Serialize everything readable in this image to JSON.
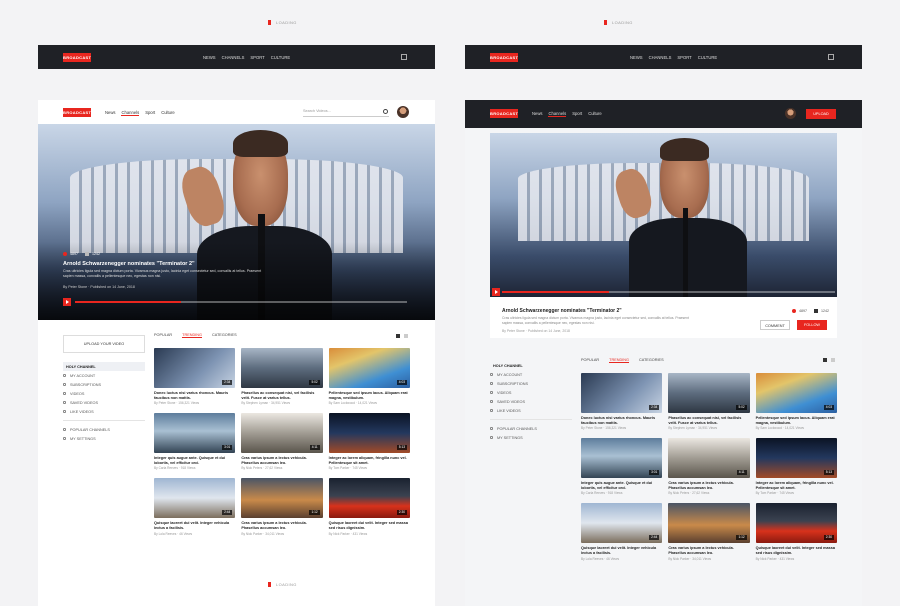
{
  "brand": {
    "logo": "BROADCAST",
    "accent": "#e8261f"
  },
  "loading_label": "LOADING",
  "preview_bar": {
    "links": [
      "NEWS",
      "CHANNELS",
      "SPORT",
      "CULTURE"
    ]
  },
  "nav": {
    "links": [
      "News",
      "Channels",
      "Sport",
      "Culture"
    ],
    "active": "Channels",
    "search_placeholder": "Search Videos...",
    "upload_button": "UPLOAD"
  },
  "hero": {
    "title": "Arnold Schwarzenegger nominates \"Terminator 2\"",
    "description": "Cras ultricies ligula sed magna dictum porta. Vivamus magna justo, lacinia eget consectetur sed, convallis at tellus. Praesent sapien massa, convallis a pellentesque nec, egestas non nisi.",
    "meta": "By Peter Stone · Published on 14 June, 2018",
    "likes": "4897",
    "comments": "1242",
    "progress": 0.32,
    "share_label": "COMMENT",
    "subscribe_label": "FOLLOW"
  },
  "sidebar": {
    "upload": "UPLOAD YOUR VIDEO",
    "items": [
      {
        "label": "HOLY CHANNEL",
        "active": true,
        "icon": "home-icon"
      },
      {
        "label": "MY ACCOUNT",
        "icon": "user-icon"
      },
      {
        "label": "SUBSCRIPTIONS",
        "icon": "subscriptions-icon"
      },
      {
        "label": "VIDEOS",
        "icon": "video-icon"
      },
      {
        "label": "SAVED VIDEOS",
        "icon": "bookmark-icon"
      },
      {
        "label": "LIKE VIDEOS",
        "icon": "heart-icon"
      }
    ],
    "extra": [
      {
        "label": "POPULAR CHANNELS",
        "icon": "star-icon"
      },
      {
        "label": "MY SETTINGS",
        "icon": "gear-icon"
      }
    ]
  },
  "tabs": [
    "POPULAR",
    "TRENDING",
    "CATEGORIES"
  ],
  "active_tab": "TRENDING",
  "videos": [
    {
      "title": "Donec luctus nisi varius rhoncus. Mauris faucibus non mattis.",
      "author": "By Peter Stone",
      "views": "156,321 Views",
      "duration": "2:34"
    },
    {
      "title": "Phasellus ac consequat nisi, vel facilisis velit. Fusce at varius tellus.",
      "author": "By Stephen Lyman",
      "views": "34,951 Views",
      "duration": "5:02"
    },
    {
      "title": "Pellentesque sed ipsum lacus. Aliquam erat magna, vestibulum.",
      "author": "By Sam Lockwood",
      "views": "14,021 Views",
      "duration": "4:03"
    },
    {
      "title": "Integer quis augue ante. Quisque et dui lobortis, vel efficitur orci.",
      "author": "By Carla Reeves",
      "views": "918 Views",
      "duration": "3:01"
    },
    {
      "title": "Cras varius ipsum a lectus vehicula. Phasellus accumsan leo.",
      "author": "By Nick Peters",
      "views": "27,62 Views",
      "duration": "4:11"
    },
    {
      "title": "Integer ac lorem aliquam, fringilla nunc vel. Pellentesque sit amet.",
      "author": "By Tom Parker",
      "views": "745 Views",
      "duration": "5:13"
    },
    {
      "title": "Quisque laoreet dui velit. Integer vehicula lectus a facilisis.",
      "author": "By Lola Reeves",
      "views": "46 Views",
      "duration": "2:44"
    },
    {
      "title": "Cras varius ipsum a lectus vehicula. Phasellus accumsan leo.",
      "author": "By Nick Parker",
      "views": "34,011 Views",
      "duration": "1:12"
    },
    {
      "title": "Quisque laoreet dui velit. Integer sed massa sed risus dignissim.",
      "author": "By Nick Parker",
      "views": "431 Views",
      "duration": "2:30"
    }
  ]
}
